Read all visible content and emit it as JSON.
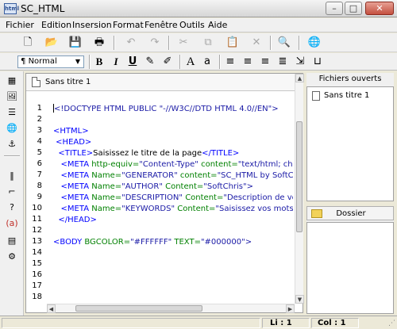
{
  "window": {
    "title": "SC_HTML",
    "icon_label": "html",
    "minimize": "–",
    "maximize": "□",
    "close": "✕"
  },
  "menu": [
    "Fichier",
    "Edition",
    "Insersion",
    "Format",
    "Fenêtre",
    "Outils",
    "Aide"
  ],
  "toolbar": {
    "style_value": "Normal",
    "style_prefix": "¶",
    "style_arrow": "▼",
    "bold": "B",
    "italic": "I",
    "underline": "U",
    "font_large": "A",
    "font_small": "a",
    "icons": {
      "new": "new-document-icon",
      "open": "open-folder-icon",
      "save": "save-disk-icon",
      "print": "print-icon",
      "undo": "undo-icon",
      "redo": "redo-icon",
      "cut": "cut-icon",
      "copy": "copy-icon",
      "paste": "paste-icon",
      "delete": "delete-icon",
      "preview": "preview-icon",
      "web": "web-globe-icon"
    }
  },
  "editor": {
    "tab_label": "Sans titre 1",
    "line_numbers": [
      "1",
      "2",
      "3",
      "4",
      "5",
      "6",
      "7",
      "8",
      "9",
      "10",
      "11",
      "12",
      "13",
      "14",
      "15",
      "16",
      "17",
      "18"
    ],
    "lines": [
      [
        {
          "t": "<!DOCTYPE HTML PUBLIC \"-//W3C//DTD HTML 4.0//EN\">",
          "c": "kw"
        }
      ],
      [],
      [
        {
          "t": "<HTML>",
          "c": "tg"
        }
      ],
      [
        {
          "t": " <HEAD>",
          "c": "tg"
        }
      ],
      [
        {
          "t": "  <TITLE>",
          "c": "tg"
        },
        {
          "t": "Saisissez le titre de la page",
          "c": "tx"
        },
        {
          "t": "</TITLE>",
          "c": "tg"
        }
      ],
      [
        {
          "t": "   <META ",
          "c": "tg"
        },
        {
          "t": "http-equiv=",
          "c": "at"
        },
        {
          "t": "\"Content-Type\" ",
          "c": "sv"
        },
        {
          "t": "content=",
          "c": "at"
        },
        {
          "t": "\"text/html; charset=",
          "c": "sv"
        }
      ],
      [
        {
          "t": "   <META ",
          "c": "tg"
        },
        {
          "t": "Name=",
          "c": "at"
        },
        {
          "t": "\"GENERATOR\" ",
          "c": "sv"
        },
        {
          "t": "content=",
          "c": "at"
        },
        {
          "t": "\"SC_HTML by SoftChri",
          "c": "sv"
        }
      ],
      [
        {
          "t": "   <META ",
          "c": "tg"
        },
        {
          "t": "Name=",
          "c": "at"
        },
        {
          "t": "\"AUTHOR\" ",
          "c": "sv"
        },
        {
          "t": "Content=",
          "c": "at"
        },
        {
          "t": "\"SoftChris\">",
          "c": "sv"
        }
      ],
      [
        {
          "t": "   <META ",
          "c": "tg"
        },
        {
          "t": "Name=",
          "c": "at"
        },
        {
          "t": "\"DESCRIPTION\" ",
          "c": "sv"
        },
        {
          "t": "Content=",
          "c": "at"
        },
        {
          "t": "\"Description de votre",
          "c": "sv"
        }
      ],
      [
        {
          "t": "   <META ",
          "c": "tg"
        },
        {
          "t": "Name=",
          "c": "at"
        },
        {
          "t": "\"KEYWORDS\" ",
          "c": "sv"
        },
        {
          "t": "Content=",
          "c": "at"
        },
        {
          "t": "\"Saisissez vos mots c",
          "c": "sv"
        }
      ],
      [
        {
          "t": "  </HEAD>",
          "c": "tg"
        }
      ],
      [],
      [
        {
          "t": "<BODY ",
          "c": "tg"
        },
        {
          "t": "BGCOLOR=",
          "c": "at"
        },
        {
          "t": "\"#FFFFFF\" ",
          "c": "sv"
        },
        {
          "t": "TEXT=",
          "c": "at"
        },
        {
          "t": "\"#000000\">",
          "c": "sv"
        }
      ],
      [],
      [],
      [],
      [],
      []
    ]
  },
  "panels": {
    "open_files_title": "Fichiers ouverts",
    "open_files": [
      "Sans titre 1"
    ],
    "folder_title": "Dossier"
  },
  "status": {
    "line_label": "Li : 1",
    "col_label": "Col : 1"
  },
  "colors": {
    "keyword": "#1a1aa6",
    "tag": "#0000ff",
    "attribute": "#008000"
  }
}
